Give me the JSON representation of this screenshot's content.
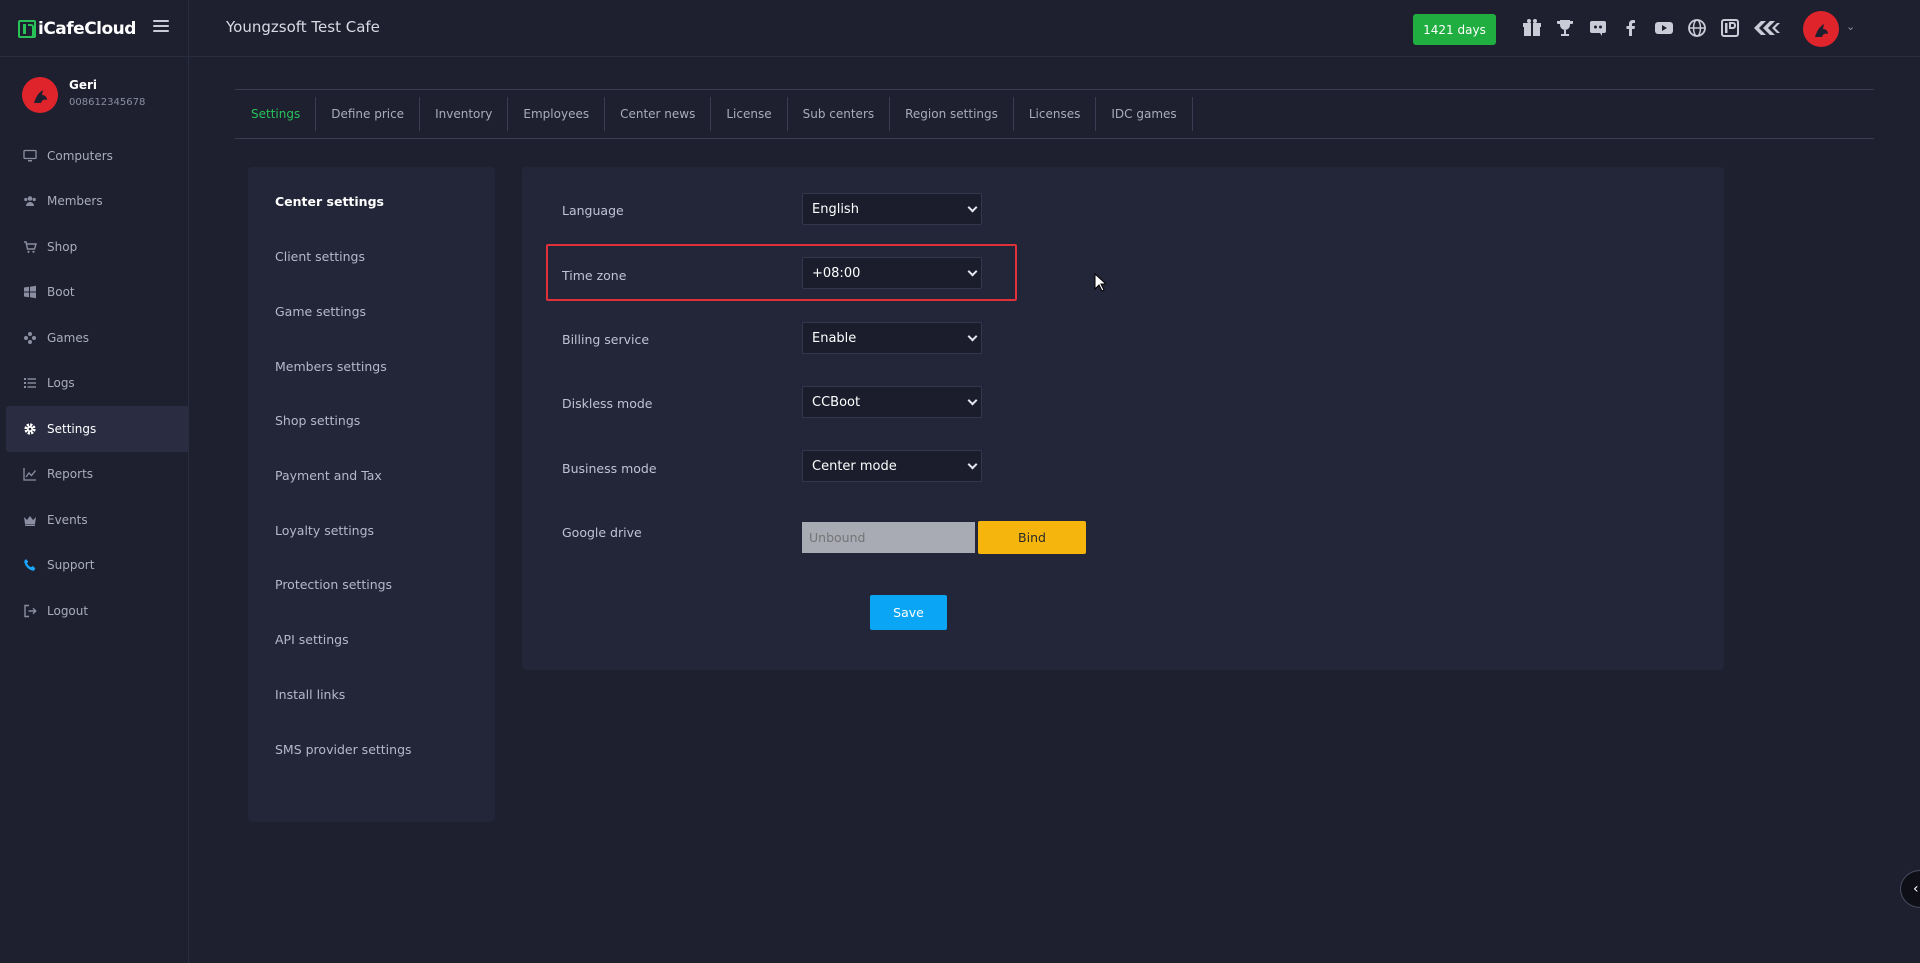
{
  "brand": {
    "name": "iCafeCloud"
  },
  "header": {
    "cafe_title": "Youngzsoft Test Cafe",
    "days_badge": "1421 days",
    "icons": [
      "gift-icon",
      "trophy-icon",
      "discord-icon",
      "facebook-icon",
      "youtube-icon",
      "globe-icon",
      "icafe-icon",
      "ccboot-icon"
    ],
    "accent_color": "#1fae3f"
  },
  "user": {
    "name": "Geri",
    "phone": "008612345678"
  },
  "sidebar": {
    "items": [
      {
        "label": "Computers",
        "icon": "monitor-icon"
      },
      {
        "label": "Members",
        "icon": "users-icon"
      },
      {
        "label": "Shop",
        "icon": "cart-icon"
      },
      {
        "label": "Boot",
        "icon": "windows-icon"
      },
      {
        "label": "Games",
        "icon": "gamepad-icon"
      },
      {
        "label": "Logs",
        "icon": "list-icon"
      },
      {
        "label": "Settings",
        "icon": "gear-icon"
      },
      {
        "label": "Reports",
        "icon": "chart-line-icon"
      },
      {
        "label": "Events",
        "icon": "crown-icon"
      },
      {
        "label": "Support",
        "icon": "phone-icon"
      },
      {
        "label": "Logout",
        "icon": "logout-icon"
      }
    ],
    "active": "Settings"
  },
  "tabs": [
    "Settings",
    "Define price",
    "Inventory",
    "Employees",
    "Center news",
    "License",
    "Sub centers",
    "Region settings",
    "Licenses",
    "IDC games"
  ],
  "settings_menu": [
    "Center settings",
    "Client settings",
    "Game settings",
    "Members settings",
    "Shop settings",
    "Payment and Tax",
    "Loyalty settings",
    "Protection settings",
    "API settings",
    "Install links",
    "SMS provider settings"
  ],
  "form": {
    "language": {
      "label": "Language",
      "value": "English"
    },
    "timezone": {
      "label": "Time zone",
      "value": "+08:00"
    },
    "billing": {
      "label": "Billing service",
      "value": "Enable"
    },
    "diskless": {
      "label": "Diskless mode",
      "value": "CCBoot"
    },
    "business": {
      "label": "Business mode",
      "value": "Center mode"
    },
    "google_drive": {
      "label": "Google drive",
      "placeholder": "Unbound",
      "bind_label": "Bind"
    },
    "save_label": "Save"
  },
  "colors": {
    "save": "#0aa5f5",
    "bind": "#f5b50c",
    "highlight": "#e0313a",
    "active_tab": "#28c258"
  }
}
